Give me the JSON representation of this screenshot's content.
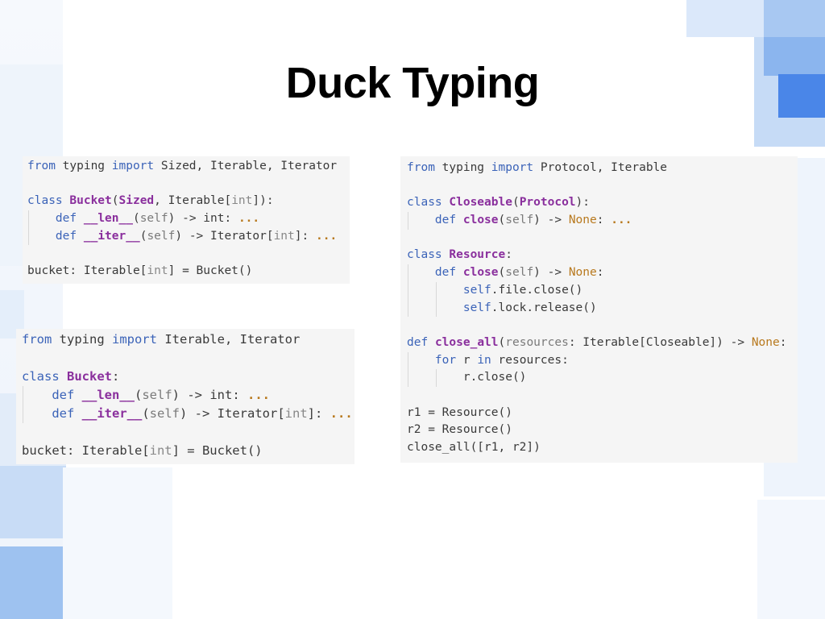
{
  "slide": {
    "title": "Duck Typing"
  },
  "colors": {
    "keyword": "#3b63b8",
    "class_name": "#8a2f9d",
    "ellipsis": "#b8791e",
    "muted": "#888888",
    "code_bg": "#f5f5f5",
    "deco_blue_dark": "#4a86e8",
    "deco_blue_light": "#c9def8"
  },
  "code_blocks": [
    {
      "name": "sized-bucket-example",
      "lines": [
        [
          [
            "kw",
            "from"
          ],
          [
            "t",
            " typing "
          ],
          [
            "kw",
            "import"
          ],
          [
            "t",
            " Sized, Iterable, Iterator"
          ]
        ],
        [],
        [
          [
            "kw",
            "class"
          ],
          [
            "t",
            " "
          ],
          [
            "cls",
            "Bucket"
          ],
          [
            "t",
            "("
          ],
          [
            "cls",
            "Sized"
          ],
          [
            "t",
            ", Iterable["
          ],
          [
            "mut",
            "int"
          ],
          [
            "t",
            "]):"
          ]
        ],
        [
          [
            "t",
            "    "
          ],
          [
            "kw",
            "def"
          ],
          [
            "t",
            " "
          ],
          [
            "dun",
            "__len__"
          ],
          [
            "t",
            "("
          ],
          [
            "arg",
            "self"
          ],
          [
            "t",
            ") -> int: "
          ],
          [
            "ell",
            "..."
          ]
        ],
        [
          [
            "t",
            "    "
          ],
          [
            "kw",
            "def"
          ],
          [
            "t",
            " "
          ],
          [
            "dun",
            "__iter__"
          ],
          [
            "t",
            "("
          ],
          [
            "arg",
            "self"
          ],
          [
            "t",
            ") -> Iterator["
          ],
          [
            "mut",
            "int"
          ],
          [
            "t",
            "]: "
          ],
          [
            "ell",
            "..."
          ]
        ],
        [],
        [
          [
            "t",
            "bucket: Iterable["
          ],
          [
            "mut",
            "int"
          ],
          [
            "t",
            "] = Bucket()"
          ]
        ]
      ]
    },
    {
      "name": "plain-bucket-example",
      "lines": [
        [
          [
            "kw",
            "from"
          ],
          [
            "t",
            " typing "
          ],
          [
            "kw",
            "import"
          ],
          [
            "t",
            " Iterable, Iterator"
          ]
        ],
        [],
        [
          [
            "kw",
            "class"
          ],
          [
            "t",
            " "
          ],
          [
            "cls",
            "Bucket"
          ],
          [
            "t",
            ":"
          ]
        ],
        [
          [
            "t",
            "    "
          ],
          [
            "kw",
            "def"
          ],
          [
            "t",
            " "
          ],
          [
            "dun",
            "__len__"
          ],
          [
            "t",
            "("
          ],
          [
            "arg",
            "self"
          ],
          [
            "t",
            ") -> int: "
          ],
          [
            "ell",
            "..."
          ]
        ],
        [
          [
            "t",
            "    "
          ],
          [
            "kw",
            "def"
          ],
          [
            "t",
            " "
          ],
          [
            "dun",
            "__iter__"
          ],
          [
            "t",
            "("
          ],
          [
            "arg",
            "self"
          ],
          [
            "t",
            ") -> Iterator["
          ],
          [
            "mut",
            "int"
          ],
          [
            "t",
            "]: "
          ],
          [
            "ell",
            "..."
          ]
        ],
        [],
        [
          [
            "t",
            "bucket: Iterable["
          ],
          [
            "mut",
            "int"
          ],
          [
            "t",
            "] = Bucket()"
          ]
        ]
      ]
    },
    {
      "name": "protocol-example",
      "lines": [
        [
          [
            "kw",
            "from"
          ],
          [
            "t",
            " typing "
          ],
          [
            "kw",
            "import"
          ],
          [
            "t",
            " Protocol, Iterable"
          ]
        ],
        [],
        [
          [
            "kw",
            "class"
          ],
          [
            "t",
            " "
          ],
          [
            "cls",
            "Closeable"
          ],
          [
            "t",
            "("
          ],
          [
            "cls",
            "Protocol"
          ],
          [
            "t",
            "):"
          ]
        ],
        [
          [
            "t",
            "    "
          ],
          [
            "kw",
            "def"
          ],
          [
            "t",
            " "
          ],
          [
            "fn",
            "close"
          ],
          [
            "t",
            "("
          ],
          [
            "arg",
            "self"
          ],
          [
            "t",
            ") -> "
          ],
          [
            "none",
            "None"
          ],
          [
            "t",
            ": "
          ],
          [
            "ell",
            "..."
          ]
        ],
        [],
        [
          [
            "kw",
            "class"
          ],
          [
            "t",
            " "
          ],
          [
            "cls",
            "Resource"
          ],
          [
            "t",
            ":"
          ]
        ],
        [
          [
            "t",
            "    "
          ],
          [
            "kw",
            "def"
          ],
          [
            "t",
            " "
          ],
          [
            "fn",
            "close"
          ],
          [
            "t",
            "("
          ],
          [
            "arg",
            "self"
          ],
          [
            "t",
            ") -> "
          ],
          [
            "none",
            "None"
          ],
          [
            "t",
            ":"
          ]
        ],
        [
          [
            "t",
            "        "
          ],
          [
            "kw",
            "self"
          ],
          [
            "t",
            ".file.close()"
          ]
        ],
        [
          [
            "t",
            "        "
          ],
          [
            "kw",
            "self"
          ],
          [
            "t",
            ".lock.release()"
          ]
        ],
        [],
        [
          [
            "kw",
            "def"
          ],
          [
            "t",
            " "
          ],
          [
            "fn",
            "close_all"
          ],
          [
            "t",
            "("
          ],
          [
            "arg",
            "resources"
          ],
          [
            "t",
            ": Iterable[Closeable]) -> "
          ],
          [
            "none",
            "None"
          ],
          [
            "t",
            ":"
          ]
        ],
        [
          [
            "t",
            "    "
          ],
          [
            "kw",
            "for"
          ],
          [
            "t",
            " r "
          ],
          [
            "kw",
            "in"
          ],
          [
            "t",
            " resources:"
          ]
        ],
        [
          [
            "t",
            "        r.close()"
          ]
        ],
        [],
        [
          [
            "t",
            "r1 = Resource()"
          ]
        ],
        [
          [
            "t",
            "r2 = Resource()"
          ]
        ],
        [
          [
            "t",
            "close_all([r1, r2])"
          ]
        ]
      ]
    }
  ]
}
